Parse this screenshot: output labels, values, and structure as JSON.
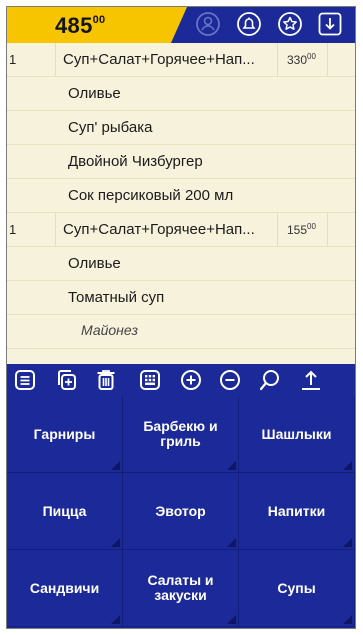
{
  "header": {
    "total_int": "485",
    "total_dec": "00",
    "icons": [
      "user-icon",
      "bell-icon",
      "star-icon",
      "download-icon"
    ]
  },
  "order": {
    "rows": [
      {
        "type": "item",
        "qty": "1",
        "name": "Суп+Салат+Горячее+Нап...",
        "price_int": "330",
        "price_dec": "00"
      },
      {
        "type": "sub",
        "name": "Оливье"
      },
      {
        "type": "sub",
        "name": "Суп' рыбака"
      },
      {
        "type": "sub",
        "name": "Двойной Чизбургер"
      },
      {
        "type": "sub",
        "name": "Сок персиковый 200 мл"
      },
      {
        "type": "item",
        "qty": "1",
        "name": "Суп+Салат+Горячее+Нап...",
        "price_int": "155",
        "price_dec": "00"
      },
      {
        "type": "sub",
        "name": "Оливье"
      },
      {
        "type": "sub",
        "name": "Томатный суп"
      },
      {
        "type": "mod",
        "name": "Майонез"
      }
    ]
  },
  "toolbar": {
    "icons": [
      "list-icon",
      "copy-add-icon",
      "trash-icon",
      "keypad-icon",
      "plus-icon",
      "minus-icon",
      "search-icon",
      "upload-icon"
    ]
  },
  "categories": [
    "Гарниры",
    "Барбекю и\nгриль",
    "Шашлыки",
    "Пицца",
    "Эвотор",
    "Напитки",
    "Сандвичи",
    "Салаты и\nзакуски",
    "Супы"
  ],
  "colors": {
    "accent": "#f7c400",
    "brand": "#1b2a98",
    "list_bg": "#f7f2dc"
  }
}
